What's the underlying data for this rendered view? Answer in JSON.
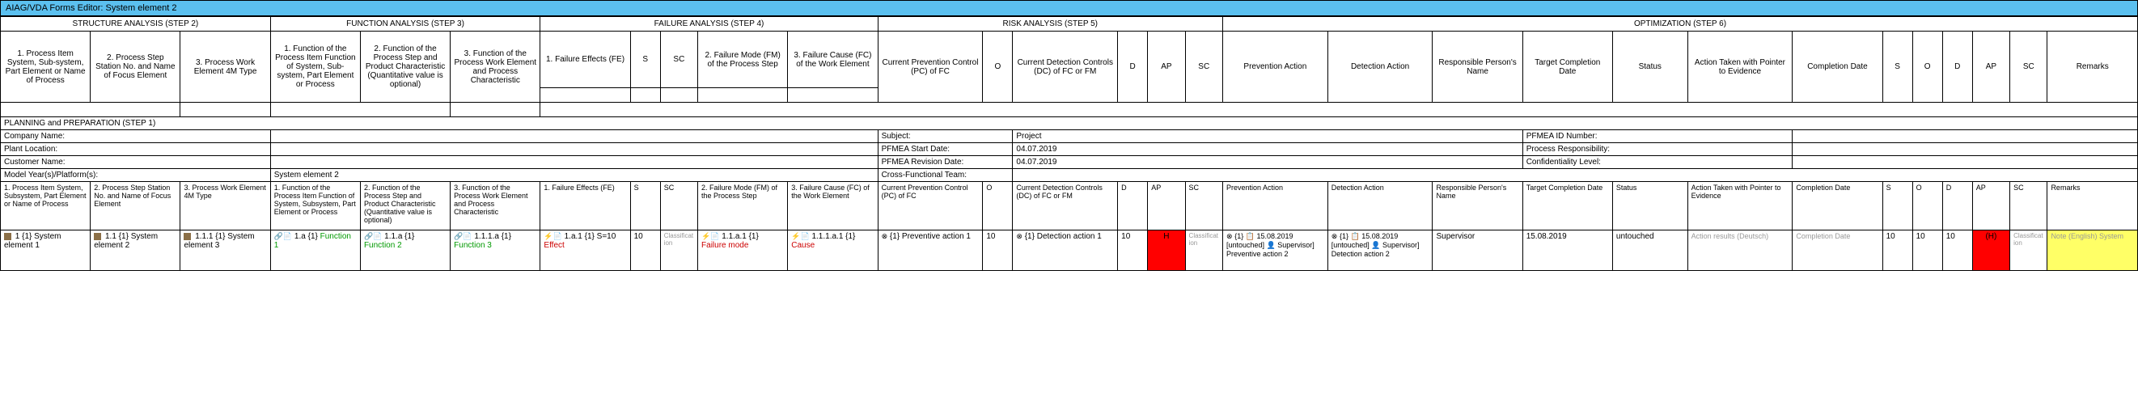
{
  "title": "AIAG/VDA Forms Editor: System element 2",
  "steps": {
    "s2": "STRUCTURE ANALYSIS (STEP 2)",
    "s3": "FUNCTION ANALYSIS (STEP 3)",
    "s4": "FAILURE ANALYSIS (STEP 4)",
    "s5": "RISK ANALYSIS (STEP 5)",
    "s6": "OPTIMIZATION (STEP 6)"
  },
  "cols": {
    "c1": "1. Process Item System, Sub-system, Part Element or Name of Process",
    "c2": "2. Process Step Station No. and Name of Focus Element",
    "c3": "3. Process Work Element 4M Type",
    "c4": "1. Function of the Process Item Function of System, Sub-system, Part Element or Process",
    "c5": "2. Function of the Process Step and Product Characteristic (Quantitative value is optional)",
    "c6": "3. Function of the Process Work Element and Process Characteristic",
    "c7": "1. Failure Effects (FE)",
    "c8": "S",
    "c9": "SC",
    "c10": "2. Failure Mode (FM) of the Process Step",
    "c11": "3. Failure Cause (FC) of the Work Element",
    "c12": "Current Prevention Control (PC) of FC",
    "c13": "O",
    "c14": "Current Detection Controls (DC) of FC or FM",
    "c15": "D",
    "c16": "AP",
    "c17": "SC",
    "c18": "Prevention Action",
    "c19": "Detection Action",
    "c20": "Responsible Person's Name",
    "c21": "Target Completion Date",
    "c22": "Status",
    "c23": "Action Taken with Pointer to Evidence",
    "c24": "Completion Date",
    "c25": "S",
    "c26": "O",
    "c27": "D",
    "c28": "AP",
    "c29": "SC",
    "c30": "Remarks"
  },
  "planning": "PLANNING and PREPARATION (STEP 1)",
  "fields": {
    "company": "Company Name:",
    "plant": "Plant Location:",
    "customer": "Customer Name:",
    "model": "Model Year(s)/Platform(s):",
    "model_val": "System element 2",
    "subject": "Subject:",
    "subject_val": "Project",
    "start": "PFMEA Start Date:",
    "start_val": "04.07.2019",
    "rev": "PFMEA Revision Date:",
    "rev_val": "04.07.2019",
    "cross": "Cross-Functional Team:",
    "pfmea_id": "PFMEA ID Number:",
    "resp": "Process Responsibility:",
    "conf": "Confidentiality Level:"
  },
  "cols2": {
    "c1": "1. Process Item System, Subsystem, Part Element or Name of Process",
    "c2": "2. Process Step Station No. and Name of Focus Element",
    "c3": "3. Process Work Element 4M Type",
    "c4": "1. Function of the Process Item Function of System, Subsystem, Part Element or Process",
    "c5": "2. Function of the Process Step and Product Characteristic (Quantitative value is optional)",
    "c6": "3. Function of the Process Work Element and Process Characteristic",
    "c7": "1. Failure Effects (FE)",
    "c8": "S",
    "c9": "SC",
    "c10": "2. Failure Mode (FM) of the Process Step",
    "c11": "3. Failure Cause (FC) of the Work Element",
    "c12": "Current Prevention Control (PC) of FC",
    "c13": "O",
    "c14": "Current Detection Controls (DC) of FC or FM",
    "c15": "D",
    "c16": "AP",
    "c17": "SC",
    "c18": "Prevention Action",
    "c19": "Detection Action",
    "c20": "Responsible Person's Name",
    "c21": "Target Completion Date",
    "c22": "Status",
    "c23": "Action Taken with Pointer to Evidence",
    "c24": "Completion Date",
    "c25": "S",
    "c26": "O",
    "c27": "D",
    "c28": "AP",
    "c29": "SC",
    "c30": "Remarks"
  },
  "row": {
    "r1": "1 {1} System element 1",
    "r2": "1.1 {1} System element 2",
    "r3": "1.1.1 {1} System element 3",
    "r4": "1.a {1} Function 1",
    "r5": "1.1.a {1} Function 2",
    "r6": "1.1.1.a {1} Function 3",
    "r7_pre": "1.a.1 {1} S=10",
    "r7_eff": "Effect",
    "r8": "10",
    "r9": "Classification",
    "r10_pre": "1.1.a.1 {1}",
    "r10_fm": "Failure mode",
    "r11_pre": "1.1.1.a.1 {1}",
    "r11_c": "Cause",
    "r12": "{1} Preventive action 1",
    "r13": "10",
    "r14": "{1} Detection action 1",
    "r15": "10",
    "r16": "H",
    "r17": "Classification",
    "r18": "{1} 📋 15.08.2019 [untouched] 👤 Supervisor] Preventive action 2",
    "r19": "{1} 📋 15.08.2019 [untouched] 👤 Supervisor] Detection action 2",
    "r20": "Supervisor",
    "r21": "15.08.2019",
    "r22": "untouched",
    "r23": "Action results (Deutsch)",
    "r24": "Completion Date",
    "r25": "10",
    "r26": "10",
    "r27": "10",
    "r28": "(H)",
    "r29": "Classification",
    "r30": "Note (English) System"
  }
}
